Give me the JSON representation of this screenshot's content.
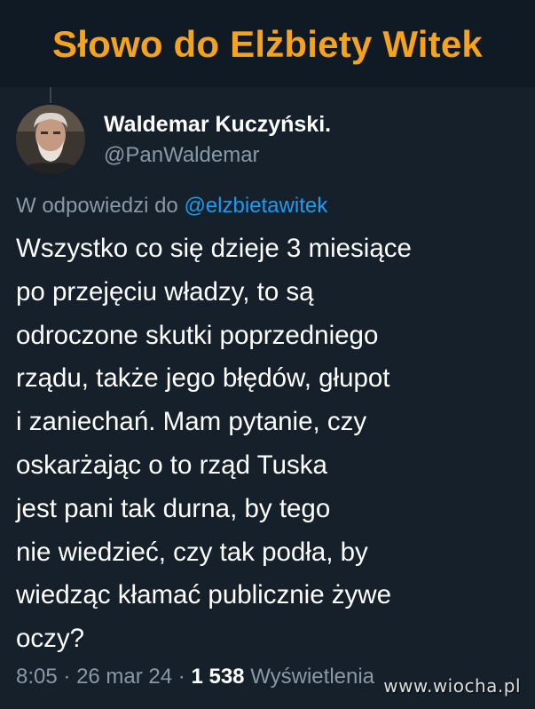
{
  "banner": {
    "title": "Słowo do Elżbiety Witek"
  },
  "tweet": {
    "author": {
      "display_name": "Waldemar Kuczyński.",
      "handle": "@PanWaldemar"
    },
    "reply_to": {
      "prefix": "W odpowiedzi do",
      "mention": "@elzbietawitek"
    },
    "text_lines": [
      "Wszystko co się dzieje 3 miesiące",
      "po przejęciu władzy, to są",
      "odroczone skutki poprzedniego",
      "rządu, także jego błędów, głupot",
      "i zaniechań. Mam pytanie, czy",
      "oskarżając o to rząd Tuska",
      "jest pani tak durna, by tego",
      "nie wiedzieć, czy tak podła, by",
      "wiedząc kłamać publicznie żywe",
      "oczy?"
    ],
    "meta": {
      "time": "8:05",
      "separator": "·",
      "date": "26 mar 24",
      "views_count": "1 538",
      "views_label": "Wyświetlenia"
    }
  },
  "watermark": "www.wiocha.pl",
  "colors": {
    "banner_text": "#f5a21e",
    "background": "#15202b",
    "secondary_text": "#8b98a5",
    "link": "#1d9bf0"
  }
}
